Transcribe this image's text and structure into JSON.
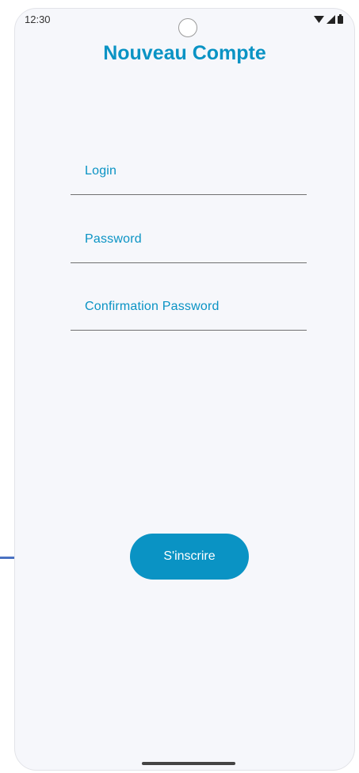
{
  "status_bar": {
    "time": "12:30",
    "icons": [
      "wifi-icon",
      "signal-icon",
      "battery-icon"
    ]
  },
  "screen": {
    "title": "Nouveau Compte"
  },
  "form": {
    "login_label": "Login",
    "password_label": "Password",
    "confirm_label": "Confirmation Password"
  },
  "actions": {
    "signup_label": "S'inscrire"
  },
  "colors": {
    "accent": "#0a93c4",
    "background": "#f6f7fb",
    "underline": "#707070",
    "connector": "#4a72c2"
  }
}
